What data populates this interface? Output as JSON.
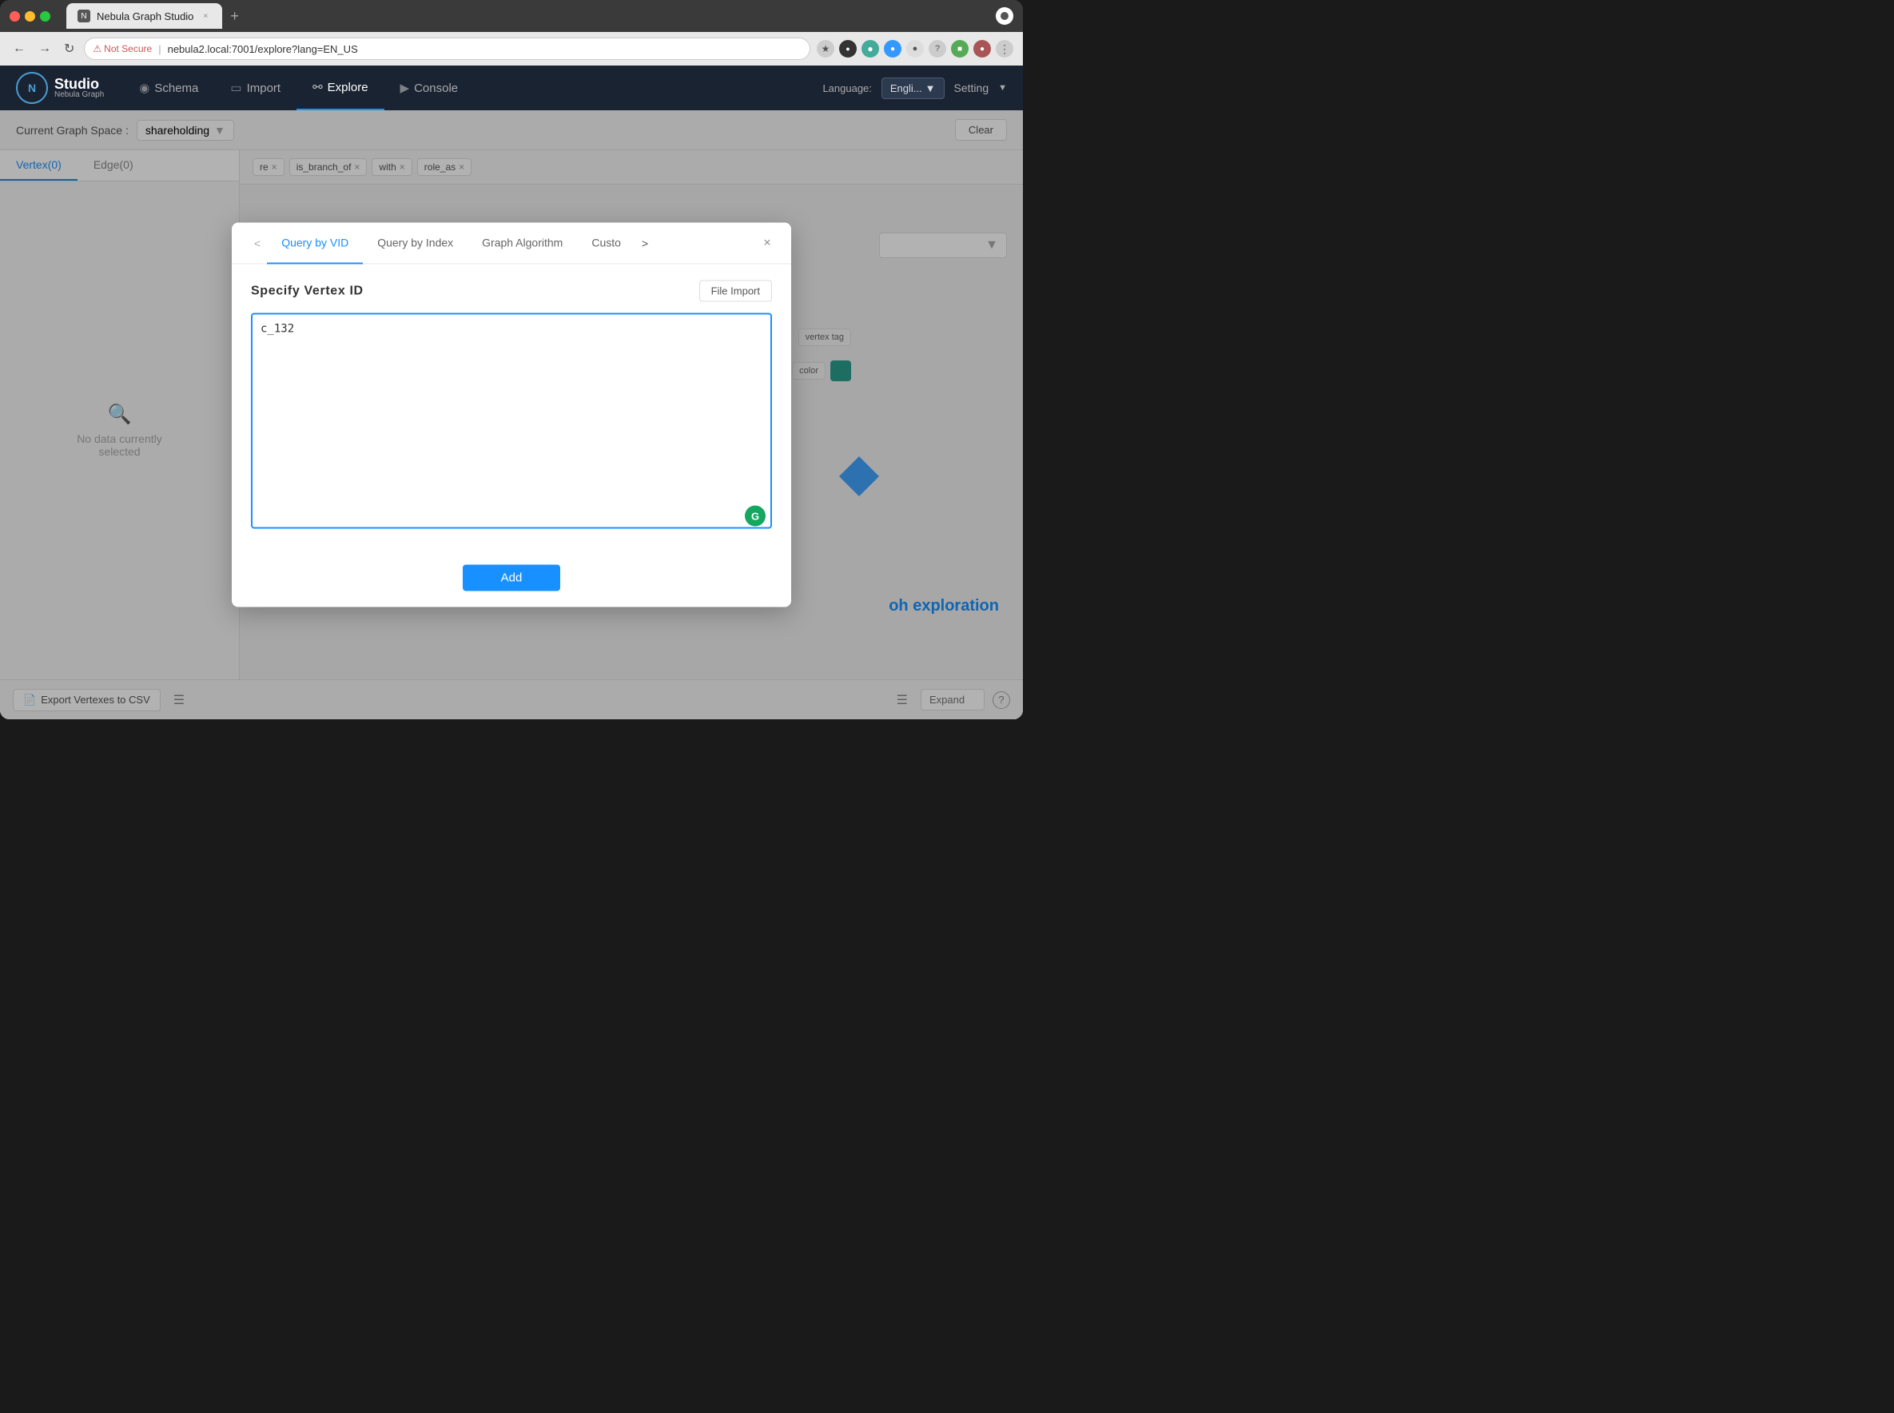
{
  "browser": {
    "tab_title": "Nebula Graph Studio",
    "tab_favicon": "N",
    "close_tab": "×",
    "new_tab": "+",
    "url": "nebula2.local:7001/explore?lang=EN_US",
    "security_warning": "Not Secure",
    "record_btn": "●"
  },
  "app": {
    "logo": {
      "icon": "N",
      "studio": "Studio",
      "sub": "Nebula Graph"
    },
    "nav": {
      "schema_label": "Schema",
      "import_label": "Import",
      "explore_label": "Explore",
      "console_label": "Console"
    },
    "language_label": "Language:",
    "language_value": "Engli...",
    "setting_label": "Setting"
  },
  "topbar": {
    "graph_space_label": "Current Graph Space :",
    "graph_space_value": "shareholding",
    "clear_btn": "Clear"
  },
  "left_panel": {
    "vertex_tab": "Vertex(0)",
    "edge_tab": "Edge(0)",
    "no_data": "No data currently\nselected"
  },
  "right_panel": {
    "tags": [
      "re",
      "is_branch_of",
      "with",
      "role_as"
    ],
    "oph_text": "oh exploration"
  },
  "bottom_bar": {
    "export_btn": "Export Vertexes to CSV",
    "expand_placeholder": "Expand",
    "help_icon": "?"
  },
  "modal": {
    "tabs": [
      {
        "id": "vid",
        "label": "Query by VID",
        "active": true
      },
      {
        "id": "index",
        "label": "Query by Index",
        "active": false
      },
      {
        "id": "algorithm",
        "label": "Graph Algorithm",
        "active": false
      },
      {
        "id": "custom",
        "label": "Custo",
        "active": false
      }
    ],
    "prev_btn": "<",
    "next_label": ">",
    "close_btn": "×",
    "subtitle": "Specify Vertex ID",
    "file_import_btn": "File Import",
    "textarea_value": "c_132",
    "textarea_placeholder": "",
    "grammarly_icon": "G",
    "add_btn": "Add"
  }
}
